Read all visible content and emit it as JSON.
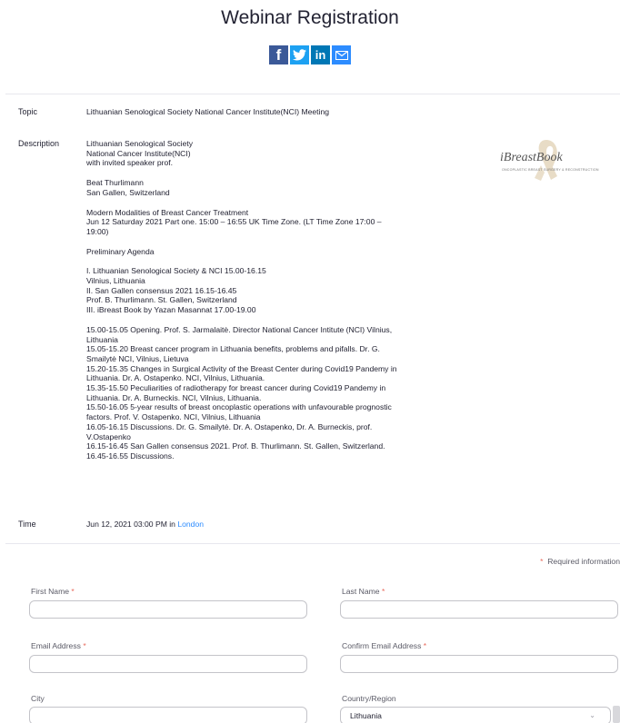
{
  "page": {
    "title": "Webinar Registration"
  },
  "share": {
    "facebook": "f",
    "twitter_icon": "twitter-bird-icon",
    "linkedin": "in",
    "email_icon": "envelope-icon"
  },
  "info": {
    "topic_label": "Topic",
    "topic_value": "Lithuanian Senological Society National Cancer Institute(NCI) Meeting",
    "description_label": "Description",
    "description_lines": [
      "Lithuanian Senological Society",
      "National Cancer Institute(NCI)",
      "with invited speaker prof.",
      "",
      "Beat Thurlimann",
      "San Gallen, Switzerland",
      "",
      "Modern Modalities of Breast Cancer Treatment",
      "Jun 12 Saturday 2021 Part one. 15:00 – 16:55 UK Time Zone. (LT Time Zone 17:00 –",
      "19:00)",
      "",
      "Preliminary Agenda",
      "",
      "I. Lithuanian Senological Society & NCI 15.00-16.15",
      "Vilnius, Lithuania",
      "II. San Gallen consensus 2021 16.15-16.45",
      "Prof. B. Thurlimann. St. Gallen, Switzerland",
      "III. iBreast Book by Yazan Masannat 17.00-19.00",
      "",
      "15.00-15.05 Opening. Prof. S. Jarmalaitė. Director National Cancer Intitute (NCI) Vilnius,",
      "Lithuania",
      "15.05-15.20 Breast cancer program in Lithuania benefits, problems and pifalls. Dr. G.",
      "Smailytė NCI, Vilnius, Lietuva",
      "15.20-15.35 Changes in Surgical Activity of the Breast Center during Covid19 Pandemy in",
      "Lithuania. Dr. A. Ostapenko. NCI, Vilnius, Lithuania.",
      "15.35-15.50 Peculiarities of radiotherapy for breast cancer during Covid19 Pandemy in",
      "Lithuania. Dr. A. Burneckis. NCI, Vilnius, Lithuania.",
      "15.50-16.05 5-year results of breast oncoplastic operations with unfavourable prognostic",
      "factors. Prof. V. Ostapenko. NCI, Vilnius, Lithuania",
      "16.05-16.15 Discussions. Dr. G. Smailytė. Dr. A. Ostapenko, Dr. A. Burneckis, prof.",
      "V.Ostapenko",
      "16.15-16.45 San Gallen consensus 2021. Prof. B. Thurlimann. St. Gallen, Switzerland.",
      "16.45-16.55 Discussions."
    ],
    "logo_text": "iBreastBook",
    "logo_tagline": "ONCOPLASTIC BREAST SURGERY & RECONSTRUCTION",
    "time_label": "Time",
    "time_value": "Jun 12, 2021 03:00 PM in ",
    "time_zone_link": "London"
  },
  "form": {
    "required_note": "Required information",
    "required_marker": "*",
    "first_name_label": "First Name",
    "last_name_label": "Last Name",
    "email_label": "Email Address",
    "confirm_email_label": "Confirm Email Address",
    "city_label": "City",
    "country_label": "Country/Region",
    "first_name_value": "",
    "last_name_value": "",
    "email_value": "",
    "confirm_email_value": "",
    "city_value": "",
    "country_value": "Lithuania"
  },
  "colors": {
    "accent": "#2d8cff",
    "required": "#e8695b",
    "facebook": "#3b5998",
    "twitter": "#1da1f2",
    "linkedin": "#0077b5"
  }
}
